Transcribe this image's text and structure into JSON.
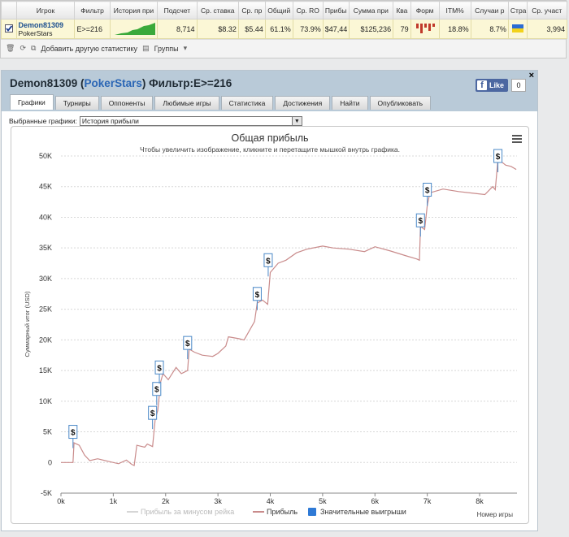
{
  "stats_table": {
    "headers": [
      "",
      "Игрок",
      "Фильтр",
      "История при",
      "Подсчет",
      "Ср. ставка",
      "Ср. пр",
      "Общий",
      "Ср. RO",
      "Прибы",
      "Сумма при",
      "Ква",
      "Форм",
      "ITM%",
      "Случаи р",
      "Стра",
      "Ср. участ"
    ],
    "row": {
      "player": "Demon81309",
      "site": "PokerStars",
      "filter": "E>=216",
      "count": "8,714",
      "avg_stake": "$8.32",
      "avg_profit": "$5.44",
      "total": "61.1%",
      "avg_roi": "73.9%",
      "profit": "$47,44",
      "sum_prize": "$125,236",
      "q": "79",
      "itm": "18.8%",
      "cases": "8.7%",
      "avg_entrants": "3,994"
    }
  },
  "toolbar": {
    "add_stats": "Добавить другую статистику",
    "groups": "Группы"
  },
  "panel": {
    "player": "Demon81309",
    "site": "PokerStars",
    "filter_text": "Фильтр:E>=216",
    "fb_like": "Like",
    "fb_count": "0",
    "tabs": [
      "Графики",
      "Турниры",
      "Оппоненты",
      "Любимые игры",
      "Статистика",
      "Достижения",
      "Найти",
      "Опубликовать"
    ],
    "select_label": "Выбранные графики:",
    "select_value": "История прибыли"
  },
  "chart_data": {
    "type": "line",
    "title": "Общая прибыль",
    "subtitle": "Чтобы увеличить изображение, кликните и перетащите мышкой внутрь графика.",
    "ylabel": "Суммарный итог (USD)",
    "xlabel": "Номер игры",
    "xlim": [
      0,
      8714
    ],
    "ylim": [
      -5000,
      50000
    ],
    "x_ticks": [
      "0k",
      "1k",
      "2k",
      "3k",
      "4k",
      "5k",
      "6k",
      "7k",
      "8k"
    ],
    "y_ticks": [
      "-5K",
      "0",
      "5K",
      "10K",
      "15K",
      "20K",
      "25K",
      "30K",
      "35K",
      "40K",
      "45K",
      "50K"
    ],
    "legend": [
      "Прибыль за минусом рейка",
      "Прибыль",
      "Значительные выигрыши"
    ],
    "series": [
      {
        "name": "Прибыль",
        "color": "#c98b8b",
        "points": [
          [
            0,
            0
          ],
          [
            230,
            0
          ],
          [
            250,
            3200
          ],
          [
            350,
            2800
          ],
          [
            450,
            1200
          ],
          [
            550,
            300
          ],
          [
            700,
            600
          ],
          [
            900,
            200
          ],
          [
            1100,
            -200
          ],
          [
            1250,
            400
          ],
          [
            1350,
            -300
          ],
          [
            1400,
            -500
          ],
          [
            1450,
            2800
          ],
          [
            1600,
            2500
          ],
          [
            1650,
            3000
          ],
          [
            1750,
            2600
          ],
          [
            1800,
            7000
          ],
          [
            1850,
            8500
          ],
          [
            1880,
            11000
          ],
          [
            1900,
            13000
          ],
          [
            1950,
            14500
          ],
          [
            2050,
            13500
          ],
          [
            2200,
            15500
          ],
          [
            2300,
            14500
          ],
          [
            2420,
            15000
          ],
          [
            2450,
            18500
          ],
          [
            2550,
            18000
          ],
          [
            2700,
            17500
          ],
          [
            2900,
            17300
          ],
          [
            3000,
            17800
          ],
          [
            3150,
            19000
          ],
          [
            3200,
            20500
          ],
          [
            3400,
            20200
          ],
          [
            3500,
            20000
          ],
          [
            3700,
            23000
          ],
          [
            3750,
            26000
          ],
          [
            3850,
            26500
          ],
          [
            3950,
            25800
          ],
          [
            4000,
            31000
          ],
          [
            4150,
            32500
          ],
          [
            4300,
            33000
          ],
          [
            4500,
            34200
          ],
          [
            4700,
            34800
          ],
          [
            5000,
            35300
          ],
          [
            5200,
            35000
          ],
          [
            5500,
            34800
          ],
          [
            5800,
            34400
          ],
          [
            6000,
            35200
          ],
          [
            6300,
            34500
          ],
          [
            6600,
            33700
          ],
          [
            6800,
            33200
          ],
          [
            6850,
            33000
          ],
          [
            6870,
            38500
          ],
          [
            6950,
            38000
          ],
          [
            7000,
            42000
          ],
          [
            7050,
            44000
          ],
          [
            7300,
            44600
          ],
          [
            7600,
            44200
          ],
          [
            7900,
            43900
          ],
          [
            8100,
            43700
          ],
          [
            8250,
            45000
          ],
          [
            8300,
            44500
          ],
          [
            8350,
            49500
          ],
          [
            8500,
            48500
          ],
          [
            8600,
            48300
          ],
          [
            8700,
            47800
          ]
        ]
      }
    ],
    "big_wins": [
      [
        230,
        5000
      ],
      [
        1750,
        8100
      ],
      [
        1830,
        12000
      ],
      [
        1880,
        15500
      ],
      [
        2420,
        19500
      ],
      [
        3750,
        27500
      ],
      [
        3960,
        33000
      ],
      [
        6870,
        39500
      ],
      [
        7000,
        44500
      ],
      [
        8350,
        50000
      ]
    ]
  }
}
